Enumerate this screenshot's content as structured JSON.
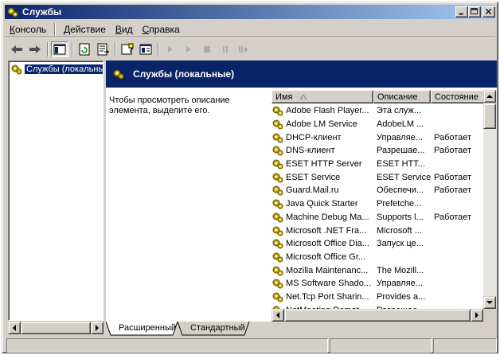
{
  "window": {
    "title": "Службы"
  },
  "menu": [
    {
      "label": "Консоль"
    },
    {
      "label": "Действие"
    },
    {
      "label": "Вид"
    },
    {
      "label": "Справка"
    }
  ],
  "tree": {
    "node_label": "Службы (локальные)"
  },
  "panel": {
    "header": "Службы (локальные)",
    "description": "Чтобы просмотреть описание элемента, выделите его."
  },
  "table": {
    "columns": [
      "Имя",
      "Описание",
      "Состояние"
    ],
    "rows": [
      {
        "name": "Adobe Flash Player...",
        "desc": "Эта служ...",
        "state": ""
      },
      {
        "name": "Adobe LM Service",
        "desc": "AdobeLM ...",
        "state": ""
      },
      {
        "name": "DHCP-клиент",
        "desc": "Управляе...",
        "state": "Работает"
      },
      {
        "name": "DNS-клиент",
        "desc": "Разрешае...",
        "state": "Работает"
      },
      {
        "name": "ESET HTTP Server",
        "desc": "ESET HTT...",
        "state": ""
      },
      {
        "name": "ESET Service",
        "desc": "ESET Service",
        "state": "Работает"
      },
      {
        "name": "Guard.Mail.ru",
        "desc": "Обеспечи...",
        "state": "Работает"
      },
      {
        "name": "Java Quick Starter",
        "desc": "Prefetche...",
        "state": ""
      },
      {
        "name": "Machine Debug Ma...",
        "desc": "Supports l...",
        "state": "Работает"
      },
      {
        "name": "Microsoft .NET Fra...",
        "desc": "Microsoft ...",
        "state": ""
      },
      {
        "name": "Microsoft Office Dia...",
        "desc": "Запуск це...",
        "state": ""
      },
      {
        "name": "Microsoft Office Gr...",
        "desc": "",
        "state": ""
      },
      {
        "name": "Mozilla Maintenanc...",
        "desc": "The Mozill...",
        "state": ""
      },
      {
        "name": "MS Software Shado...",
        "desc": "Управляе...",
        "state": ""
      },
      {
        "name": "Net.Tcp Port Sharin...",
        "desc": "Provides a...",
        "state": ""
      },
      {
        "name": "NetMeeting Remot...",
        "desc": "Разрешае...",
        "state": ""
      }
    ]
  },
  "tabs": [
    {
      "label": "Расширенный"
    },
    {
      "label": "Стандартный"
    }
  ]
}
